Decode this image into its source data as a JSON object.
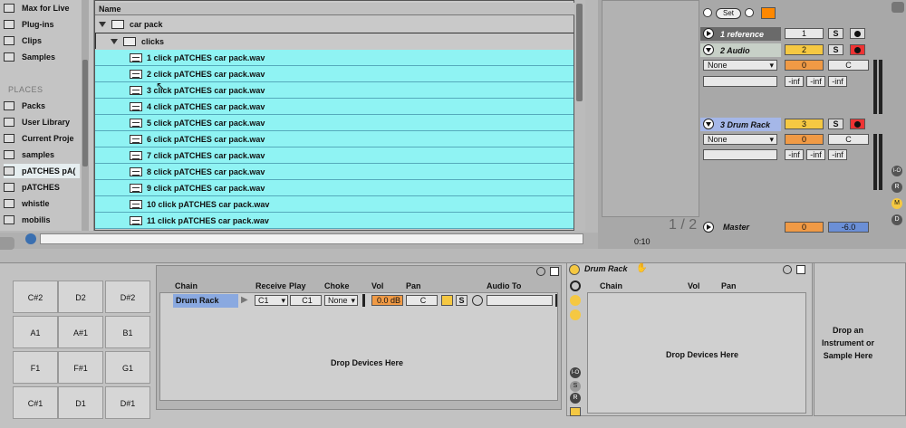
{
  "browser": {
    "top_items": [
      {
        "label": "Max for Live"
      },
      {
        "label": "Plug-ins"
      },
      {
        "label": "Clips"
      },
      {
        "label": "Samples"
      }
    ],
    "places_heading": "PLACES",
    "places": [
      {
        "label": "Packs"
      },
      {
        "label": "User Library"
      },
      {
        "label": "Current Proje"
      },
      {
        "label": "samples"
      },
      {
        "label": "pATCHES pA("
      },
      {
        "label": "pATCHES"
      },
      {
        "label": "whistle"
      },
      {
        "label": "mobilis"
      }
    ],
    "column_header": "Name",
    "folders": [
      {
        "label": "car pack"
      },
      {
        "label": "clicks"
      }
    ],
    "files": [
      {
        "label": "1 click pATCHES car pack.wav"
      },
      {
        "label": "2 click pATCHES car pack.wav"
      },
      {
        "label": "3 click pATCHES car pack.wav"
      },
      {
        "label": "4 click pATCHES car pack.wav"
      },
      {
        "label": "5 click pATCHES car pack.wav"
      },
      {
        "label": "6 click pATCHES car pack.wav"
      },
      {
        "label": "7 click pATCHES car pack.wav"
      },
      {
        "label": "8 click pATCHES car pack.wav"
      },
      {
        "label": "9 click pATCHES car pack.wav"
      },
      {
        "label": "10 click pATCHES car pack.wav"
      },
      {
        "label": "11 click pATCHES car pack.wav"
      }
    ]
  },
  "session": {
    "set_label": "Set",
    "tracks": [
      {
        "name": "1 reference",
        "number": "1"
      },
      {
        "name": "2 Audio",
        "number": "2",
        "input": "None",
        "volume": "0",
        "pan": "C",
        "inf": [
          "-inf",
          "-inf",
          "-inf"
        ]
      },
      {
        "name": "3 Drum Rack",
        "number": "3",
        "input": "None",
        "volume": "0",
        "pan": "C",
        "inf": [
          "-inf",
          "-inf",
          "-inf"
        ]
      }
    ],
    "master": {
      "name": "Master",
      "volume": "0",
      "pan": "-6.0"
    },
    "solo_label": "S",
    "page_indicator": "1 / 2",
    "time_marker": "0:10",
    "side_buttons": [
      "I-O",
      "R",
      "M",
      "D"
    ]
  },
  "drum_rack": {
    "pads": [
      [
        "C#2",
        "D2",
        "D#2"
      ],
      [
        "A1",
        "A#1",
        "B1"
      ],
      [
        "F1",
        "F#1",
        "G1"
      ],
      [
        "C#1",
        "D1",
        "D#1"
      ]
    ],
    "chain_headers": {
      "chain": "Chain",
      "receive": "Receive",
      "play": "Play",
      "choke": "Choke",
      "vol": "Vol",
      "pan": "Pan",
      "audio_to": "Audio To"
    },
    "chain": {
      "name": "Drum Rack",
      "receive": "C1",
      "play": "C1",
      "choke": "None",
      "vol": "0.0 dB",
      "pan": "C",
      "solo": "S"
    },
    "drop_devices": "Drop Devices Here"
  },
  "inner_rack": {
    "title": "Drum Rack",
    "headers": {
      "chain": "Chain",
      "vol": "Vol",
      "pan": "Pan"
    },
    "drop_devices": "Drop Devices Here",
    "drop_instrument": "Drop an Instrument or Sample Here"
  }
}
